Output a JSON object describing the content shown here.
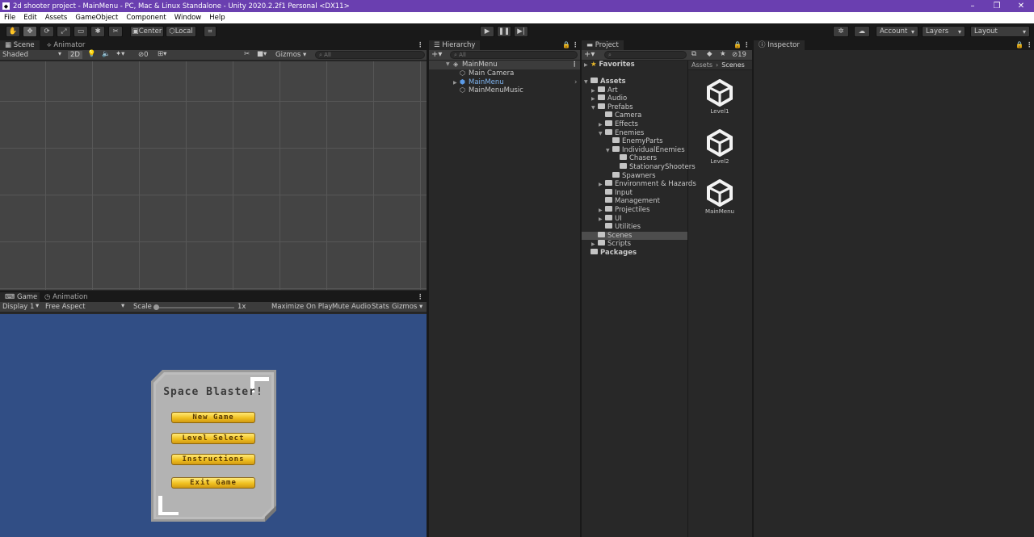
{
  "window": {
    "title": "2d shooter project - MainMenu - PC, Mac & Linux Standalone - Unity 2020.2.2f1 Personal <DX11>"
  },
  "menubar": [
    "File",
    "Edit",
    "Assets",
    "GameObject",
    "Component",
    "Window",
    "Help"
  ],
  "toolbar": {
    "pivot_label": "Center",
    "space_label": "Local",
    "account_label": "Account",
    "layers_label": "Layers",
    "layout_label": "Layout"
  },
  "scene": {
    "tab_label": "Scene",
    "animator_tab_label": "Animator",
    "shading_mode": "Shaded",
    "mode_2d": "2D",
    "hidden_count": "0",
    "gizmos_label": "Gizmos",
    "search_placeholder": "All"
  },
  "game": {
    "tab_label": "Game",
    "animation_tab_label": "Animation",
    "display": "Display 1",
    "aspect": "Free Aspect",
    "scale_label": "Scale",
    "scale_value": "1x",
    "maximize": "Maximize On Play",
    "mute": "Mute Audio",
    "stats": "Stats",
    "gizmos": "Gizmos",
    "menu": {
      "title": "Space Blaster!",
      "buttons": [
        "New Game",
        "Level Select",
        "Instructions",
        "Exit Game"
      ]
    }
  },
  "hierarchy": {
    "tab_label": "Hierarchy",
    "search_placeholder": "All",
    "scene_name": "MainMenu",
    "objects": [
      "Main Camera",
      "MainMenu",
      "MainMenuMusic"
    ]
  },
  "project": {
    "tab_label": "Project",
    "hidden_count": "19",
    "favorites": "Favorites",
    "breadcrumb": [
      "Assets",
      "Scenes"
    ],
    "tree": [
      {
        "label": "Assets",
        "depth": 0,
        "bold": true,
        "arrow": "open"
      },
      {
        "label": "Art",
        "depth": 1,
        "arrow": "closed"
      },
      {
        "label": "Audio",
        "depth": 1,
        "arrow": "closed"
      },
      {
        "label": "Prefabs",
        "depth": 1,
        "arrow": "open"
      },
      {
        "label": "Camera",
        "depth": 2,
        "arrow": "none"
      },
      {
        "label": "Effects",
        "depth": 2,
        "arrow": "closed"
      },
      {
        "label": "Enemies",
        "depth": 2,
        "arrow": "open"
      },
      {
        "label": "EnemyParts",
        "depth": 3,
        "arrow": "none"
      },
      {
        "label": "IndividualEnemies",
        "depth": 3,
        "arrow": "open"
      },
      {
        "label": "Chasers",
        "depth": 4,
        "arrow": "none"
      },
      {
        "label": "StationaryShooters",
        "depth": 4,
        "arrow": "none"
      },
      {
        "label": "Spawners",
        "depth": 3,
        "arrow": "none"
      },
      {
        "label": "Environment & Hazards",
        "depth": 2,
        "arrow": "closed"
      },
      {
        "label": "Input",
        "depth": 2,
        "arrow": "none"
      },
      {
        "label": "Management",
        "depth": 2,
        "arrow": "none"
      },
      {
        "label": "Projectiles",
        "depth": 2,
        "arrow": "closed"
      },
      {
        "label": "UI",
        "depth": 2,
        "arrow": "closed"
      },
      {
        "label": "Utilities",
        "depth": 2,
        "arrow": "none"
      },
      {
        "label": "Scenes",
        "depth": 1,
        "arrow": "none",
        "selected": true
      },
      {
        "label": "Scripts",
        "depth": 1,
        "arrow": "closed"
      },
      {
        "label": "Packages",
        "depth": 0,
        "bold": true,
        "arrow": "none"
      }
    ],
    "scenes": [
      "Level1",
      "Level2",
      "MainMenu"
    ]
  },
  "inspector": {
    "tab_label": "Inspector"
  },
  "colors": {
    "title_bar": "#6a3fb0",
    "game_bg": "#314e85",
    "button_yellow": "#f0c020",
    "selection": "#4d4d4d"
  }
}
